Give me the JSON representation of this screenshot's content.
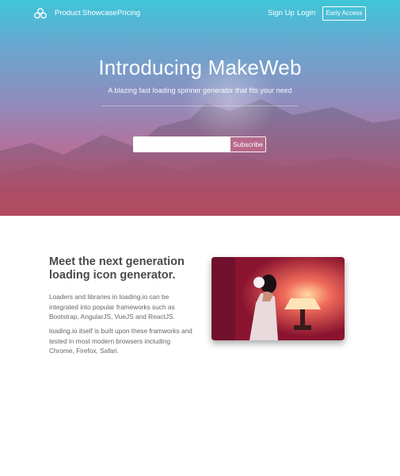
{
  "nav": {
    "logo_icon": "cloud-logo-icon",
    "links": [
      "Product",
      "Showcase",
      "Pricing"
    ],
    "sign_up": "Sign Up",
    "login": "Login",
    "early_access": "Early Access"
  },
  "hero": {
    "title": "Introducing MakeWeb",
    "subtitle": "A blazing fast loading spinner generator that fits your need",
    "input_value": "",
    "subscribe_label": "Subscribe",
    "gradient_top": "#3fc6d9",
    "gradient_bottom": "#d8566f"
  },
  "feature": {
    "title": "Meet the next generation loading icon generator.",
    "paragraph1": "Loaders and libraries in loading.io can be integrated into popular frameworks such as Bootstrap, AngularJS, VueJS and ReactJS.",
    "paragraph2": "loading.io itself is built upon these framworks and tested in most modern browsers including Chrome, Firefox, Safari."
  }
}
